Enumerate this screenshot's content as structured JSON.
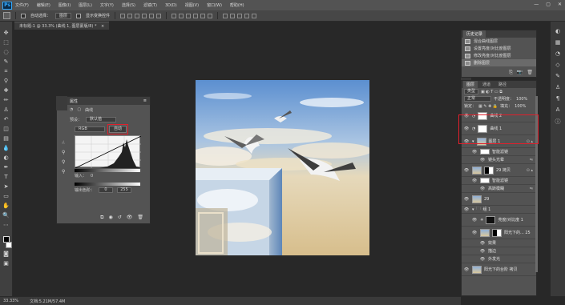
{
  "app": {
    "logo": "Ps"
  },
  "menu": [
    "文件(F)",
    "编辑(E)",
    "图像(I)",
    "图层(L)",
    "文字(Y)",
    "选择(S)",
    "滤镜(T)",
    "3D(D)",
    "视图(V)",
    "窗口(W)",
    "帮助(H)"
  ],
  "window_controls": [
    "—",
    "▢",
    "✕"
  ],
  "options": {
    "auto_select_label": "自动选择：",
    "auto_select_value": "图层",
    "show_transform": "显示变换控件"
  },
  "doc_tab": {
    "title": "未标题-1 @ 33.3% (曲线 1, 图层蒙版/8) *",
    "close": "×"
  },
  "properties": {
    "title": "属性",
    "adjustment": "曲线",
    "preset_label": "预设：",
    "preset_value": "默认值",
    "channel": "RGB",
    "auto_button": "自动",
    "input_label": "输入：",
    "input_value": "0",
    "output_label": "输出色阶：",
    "output_low": "0",
    "output_high": "255",
    "footer_icons": [
      "⧉",
      "◉",
      "↺",
      "👁",
      "🗑"
    ]
  },
  "history": {
    "tabs": [
      "历史记录"
    ],
    "items": [
      {
        "label": "混合曲线图层",
        "selected": false
      },
      {
        "label": "设置亮度/对比度图层",
        "selected": false
      },
      {
        "label": "修改亮度/对比度图层",
        "selected": false
      },
      {
        "label": "删除图层",
        "selected": true
      }
    ],
    "footer_icons": [
      "⎘",
      "📷",
      "🗑"
    ]
  },
  "layers": {
    "tabs": [
      "图层",
      "通道",
      "路径"
    ],
    "filter_label": "类型",
    "blend_mode": "正常",
    "opacity_label": "不透明度：",
    "opacity_value": "100%",
    "lock_label": "锁定：",
    "fill_label": "填充：",
    "fill_value": "100%",
    "items": [
      {
        "name": "曲线 2"
      },
      {
        "name": "曲线 1"
      },
      {
        "name": "图层 1"
      },
      {
        "name": "智能滤镜"
      },
      {
        "name": "镜头光晕"
      },
      {
        "name": "29 拷贝"
      },
      {
        "name": "智能滤镜"
      },
      {
        "name": "高斯模糊"
      },
      {
        "name": "29"
      },
      {
        "name": "组 1"
      },
      {
        "name": "亮度/对比度 1"
      },
      {
        "name": "阳光下的... 25"
      },
      {
        "name": "效果"
      },
      {
        "name": "描边"
      },
      {
        "name": "外发光"
      },
      {
        "name": "阳光下的台阶 拷贝"
      }
    ]
  },
  "status": {
    "zoom": "33.33%",
    "doc": "文档:5.21M/57.4M"
  }
}
